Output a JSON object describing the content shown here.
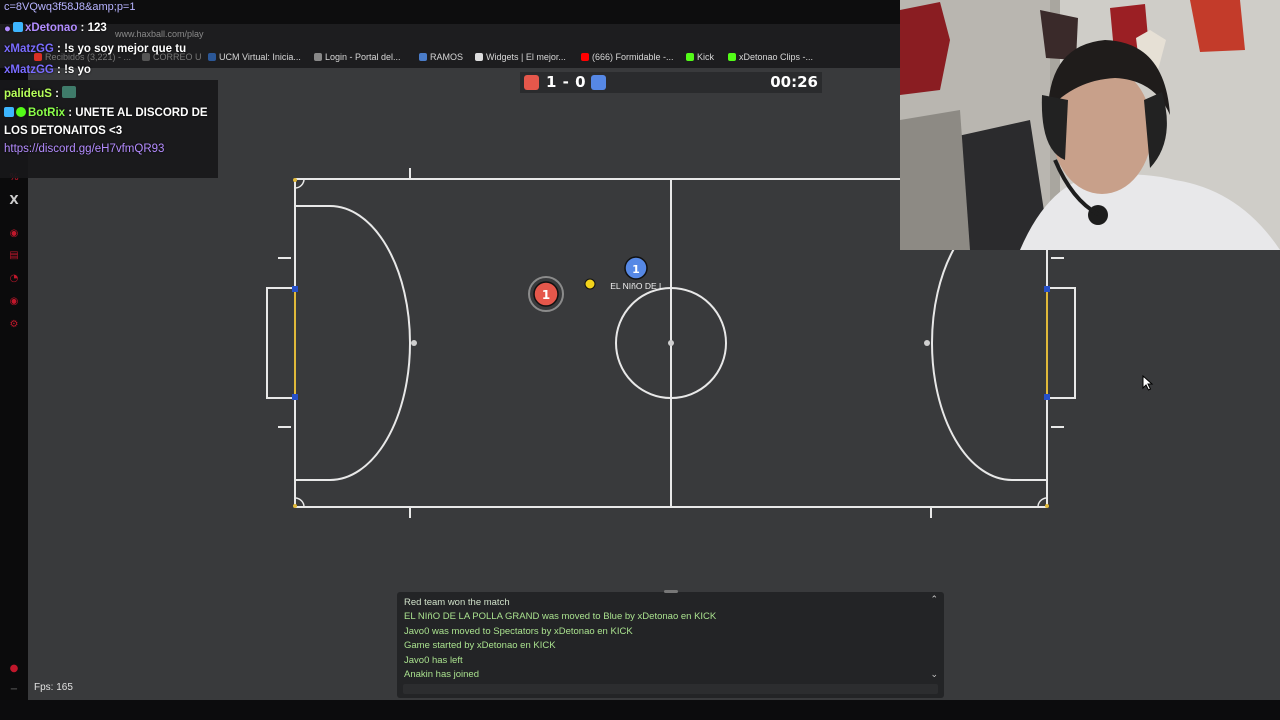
{
  "browser": {
    "top_url": "c=8VQwq3f58J8&amp;p=1",
    "address": "www.haxball.com/play",
    "bookmarks": [
      {
        "label": "Recibidos (3,221) - ...",
        "color": "#d93025"
      },
      {
        "label": "CORREO U",
        "color": "#555555"
      },
      {
        "label": "UCM Virtual: Inicia...",
        "color": "#2b5797"
      },
      {
        "label": "Login - Portal del...",
        "color": "#888888"
      },
      {
        "label": "RAMOS",
        "color": "#4a7cc9"
      },
      {
        "label": "Widgets | El mejor...",
        "color": "#dddddd"
      },
      {
        "label": "(666) Formidable -...",
        "color": "#ff0000"
      },
      {
        "label": "Kick",
        "color": "#53fc18"
      },
      {
        "label": "xDetonao Clips -...",
        "color": "#53fc18"
      }
    ]
  },
  "overlay_chat": [
    {
      "user": "xDetonao",
      "sep": " : ",
      "message": "123",
      "user_color": "#b18cff"
    },
    {
      "user": "xMatzGG",
      "sep": " : ",
      "message": "!s yo soy mejor que tu",
      "user_color": "#7a6cff"
    },
    {
      "user": "xMatzGG",
      "sep": " : ",
      "message": "!s yo",
      "user_color": "#7a6cff"
    },
    {
      "user": "palideuS",
      "sep": " : ",
      "message": "",
      "user_color": "#b6ff5a"
    },
    {
      "user": "BotRix",
      "sep": " : ",
      "message": "UNETE AL DISCORD DE",
      "user_color": "#8bff4a"
    },
    {
      "user": "",
      "sep": "",
      "message": "LOS DETONAITOS <3",
      "user_color": "#ffffff"
    },
    {
      "user": "",
      "sep": "",
      "message": "https://discord.gg/eH7vfmQR93",
      "user_color": "#b48cff"
    }
  ],
  "scoreboard": {
    "red_color": "#e5574b",
    "blue_color": "#5688e5",
    "score": "1 - 0",
    "time": "00:26"
  },
  "players": [
    {
      "team": "red",
      "number": "1",
      "name": ""
    },
    {
      "team": "blue",
      "number": "1",
      "name": "EL NIñO DE L"
    }
  ],
  "game_chat": [
    {
      "text": "Red team won the match",
      "style": "plain"
    },
    {
      "text": "EL NIñO DE LA POLLA GRAND was moved to Blue by xDetonao en KICK",
      "style": "green"
    },
    {
      "text": "Javo0 was moved to Spectators by xDetonao en KICK",
      "style": "green"
    },
    {
      "text": "Game started by xDetonao en KICK",
      "style": "green"
    },
    {
      "text": "Javo0 has left",
      "style": "green"
    },
    {
      "text": "Anakin has joined",
      "style": "green"
    }
  ],
  "fps": "Fps: 165",
  "icons": [
    "mic-icon",
    "kick-badge-icon",
    "twitter-x-icon",
    "cursor-arrow-icon",
    "chevron-up-icon",
    "chevron-down-icon"
  ]
}
